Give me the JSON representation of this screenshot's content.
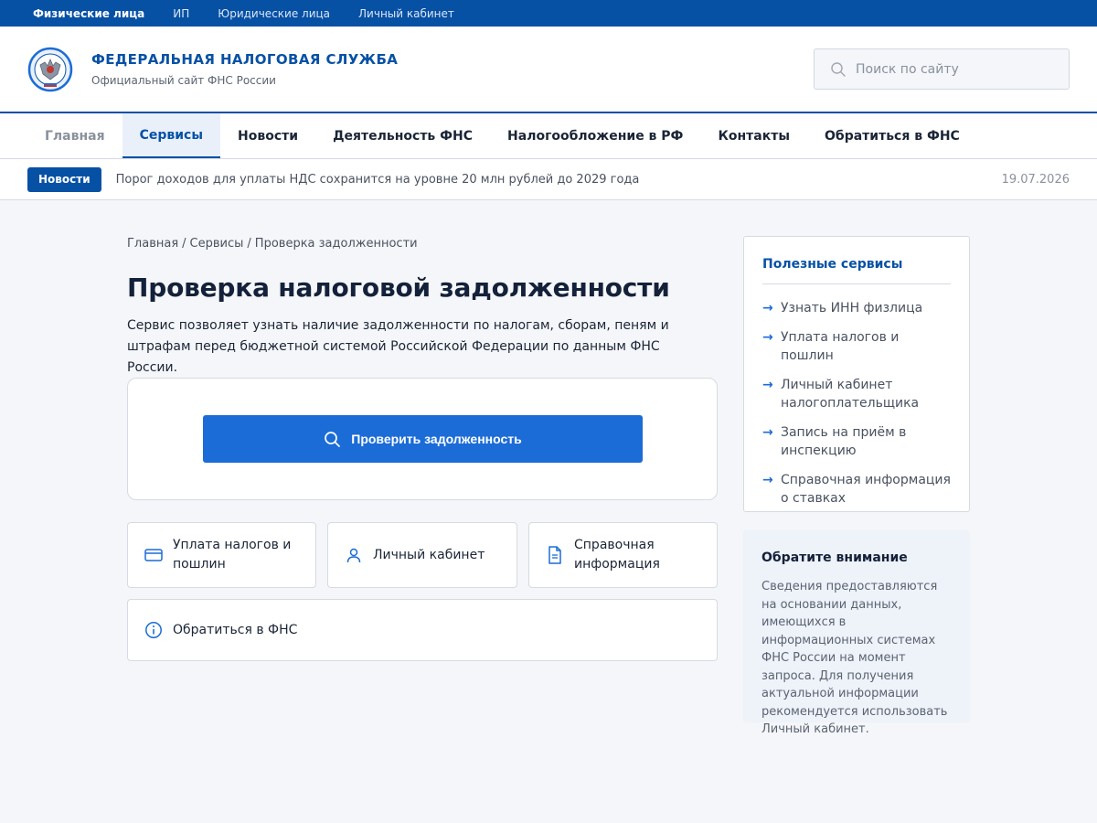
{
  "topbar": {
    "items": [
      {
        "label": "Физические лица",
        "active": true
      },
      {
        "label": "ИП",
        "active": false
      },
      {
        "label": "Юридические лица",
        "active": false
      },
      {
        "label": "Личный кабинет",
        "active": false
      }
    ]
  },
  "header": {
    "title": "ФЕДЕРАЛЬНАЯ НАЛОГОВАЯ СЛУЖБА",
    "subtitle": "Официальный сайт ФНС России",
    "search_placeholder": "Поиск по сайту"
  },
  "nav": {
    "items": [
      {
        "label": "Главная"
      },
      {
        "label": "Сервисы"
      },
      {
        "label": "Новости"
      },
      {
        "label": "Деятельность ФНС"
      },
      {
        "label": "Налогообложение в РФ"
      },
      {
        "label": "Контакты"
      },
      {
        "label": "Обратиться в ФНС"
      }
    ],
    "active_index": 1
  },
  "ticker": {
    "badge": "Новости",
    "text": "Порог доходов для уплаты НДС сохранится на уровне 20 млн рублей до 2029 года",
    "date": "19.07.2026"
  },
  "breadcrumb": [
    "Главная",
    "Сервисы",
    "Проверка задолженности"
  ],
  "page": {
    "title": "Проверка налоговой задолженности",
    "lead": "Сервис позволяет узнать наличие задолженности по налогам, сборам, пеням и штрафам перед бюджетной системой Российской Федерации по данным ФНС России.",
    "check_button": "Проверить задолженность"
  },
  "tiles": [
    {
      "label": "Уплата налогов и пошлин",
      "icon": "card-icon"
    },
    {
      "label": "Личный кабинет",
      "icon": "user-icon"
    },
    {
      "label": "Справочная информация",
      "icon": "document-icon"
    },
    {
      "label": "Обратиться в ФНС",
      "icon": "info-icon"
    }
  ],
  "sidebar": {
    "title": "Полезные сервисы",
    "items": [
      "Узнать ИНН физлица",
      "Уплата налогов и пошлин",
      "Личный кабинет налогоплательщика",
      "Запись на приём в инспекцию",
      "Справочная информация о ставках"
    ],
    "arrow": "→"
  },
  "notice": {
    "title": "Обратите внимание",
    "text": "Сведения предоставляются на основании данных, имеющихся в информационных системах ФНС России на момент запроса. Для получения актуальной информации рекомендуется использовать Личный кабинет."
  },
  "colors": {
    "brand": "#0751a5",
    "button": "#1b6cd7",
    "page_bg": "#f5f6f9"
  }
}
